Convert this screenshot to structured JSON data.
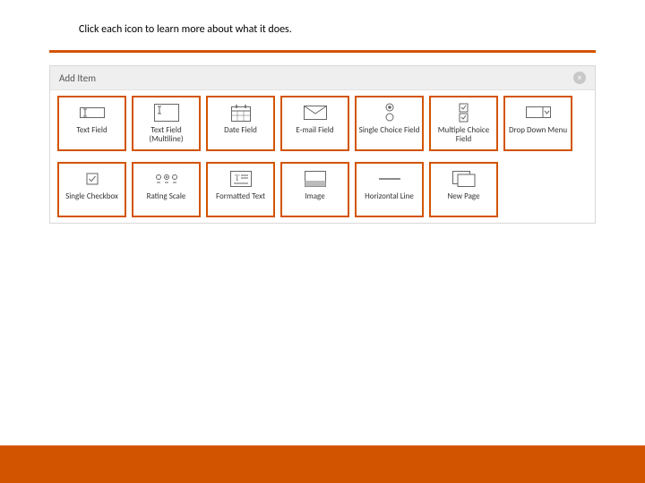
{
  "instruction": "Click each icon to learn more about what it does.",
  "panel": {
    "title": "Add Item",
    "close_label": "×"
  },
  "tiles": {
    "text_field": "Text Field",
    "text_field_multiline": "Text Field (Multiline)",
    "date_field": "Date Field",
    "email_field": "E-mail Field",
    "single_choice": "Single Choice Field",
    "multiple_choice": "Multiple Choice Field",
    "drop_down": "Drop Down Menu",
    "single_checkbox": "Single Checkbox",
    "rating_scale": "Rating Scale",
    "formatted_text": "Formatted Text",
    "image": "Image",
    "horizontal_line": "Horizontal Line",
    "new_page": "New Page"
  },
  "colors": {
    "accent": "#d35400"
  }
}
